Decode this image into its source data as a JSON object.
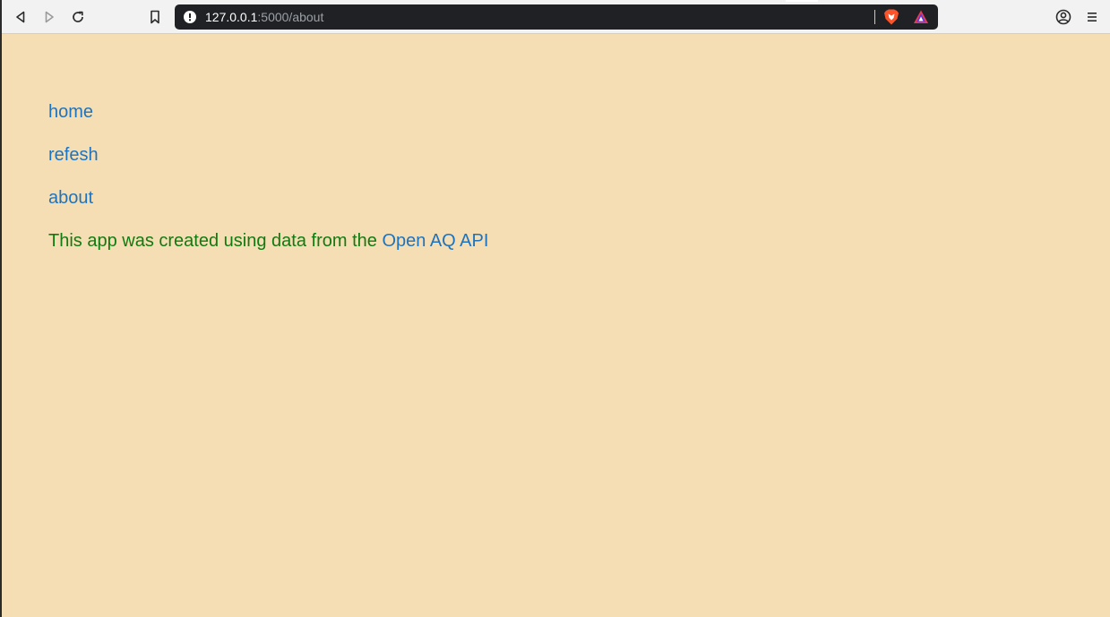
{
  "browser": {
    "url_host": "127.0.0.1",
    "url_path": ":5000/about",
    "icons": {
      "back": "back-arrow-icon",
      "forward": "forward-arrow-icon",
      "reload": "reload-icon",
      "bookmark": "bookmark-icon",
      "site_info": "info-icon",
      "shields": "brave-shields-icon",
      "rewards": "brave-rewards-icon",
      "profile": "profile-icon",
      "menu": "menu-icon"
    },
    "colors": {
      "toolbar": "#f2f2f2",
      "urlbar": "#202124",
      "url_host": "#ffffff",
      "url_path": "#9aa0a6"
    }
  },
  "page": {
    "background": "#f5deb3",
    "nav": [
      {
        "label": "home"
      },
      {
        "label": "refesh"
      },
      {
        "label": "about"
      }
    ],
    "about_text": "This app was created using data from the",
    "about_link": "Open AQ API",
    "colors": {
      "link": "#1e73be",
      "text": "#117a11"
    }
  }
}
